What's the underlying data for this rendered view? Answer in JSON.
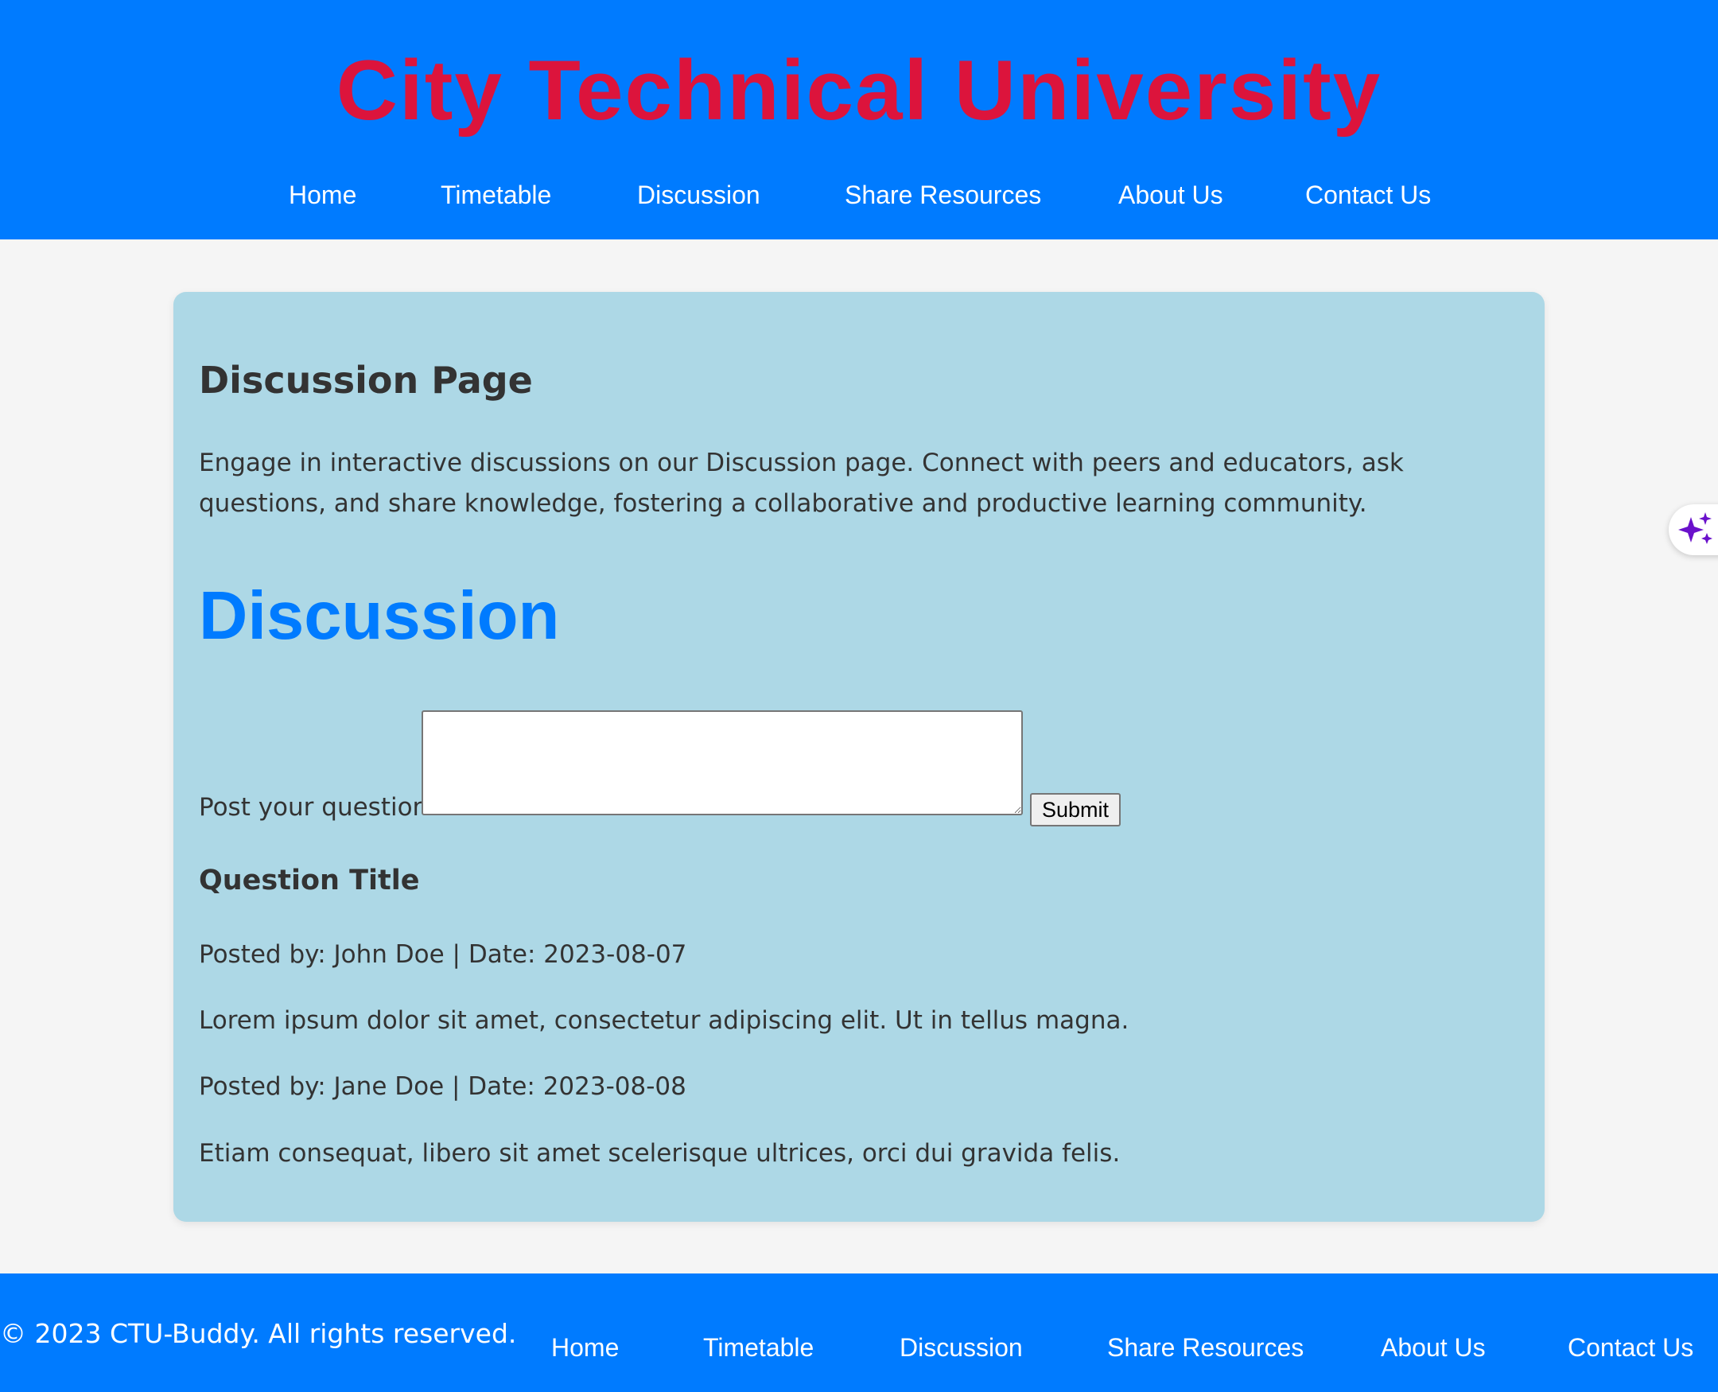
{
  "header": {
    "title": "City Technical University",
    "nav": [
      "Home",
      "Timetable",
      "Discussion",
      "Share Resources",
      "About Us",
      "Contact Us"
    ]
  },
  "main": {
    "page_title": "Discussion Page",
    "intro": "Engage in interactive discussions on our Discussion page. Connect with peers and educators, ask questions, and share knowledge, fostering a collaborative and productive learning community.",
    "section_heading": "Discussion",
    "form": {
      "label": "Post your question:",
      "value": "",
      "submit_label": "Submit"
    },
    "question": {
      "title": "Question Title",
      "posts": [
        {
          "meta": "Posted by: John Doe | Date: 2023-08-07",
          "text": "Lorem ipsum dolor sit amet, consectetur adipiscing elit. Ut in tellus magna."
        },
        {
          "meta": "Posted by: Jane Doe | Date: 2023-08-08",
          "text": "Etiam consequat, libero sit amet scelerisque ultrices, orci dui gravida felis."
        }
      ]
    }
  },
  "footer": {
    "copyright": "© 2023 CTU-Buddy. All rights reserved.",
    "nav": [
      "Home",
      "Timetable",
      "Discussion",
      "Share Resources",
      "About Us",
      "Contact Us"
    ]
  },
  "assistant": {
    "icon": "sparkle-icon"
  },
  "colors": {
    "header_bg": "#007bff",
    "title_text": "#dc143c",
    "card_bg": "#add8e6",
    "heading_accent": "#007bff",
    "page_bg": "#f5f5f5",
    "sparkle": "#6a11cb"
  }
}
